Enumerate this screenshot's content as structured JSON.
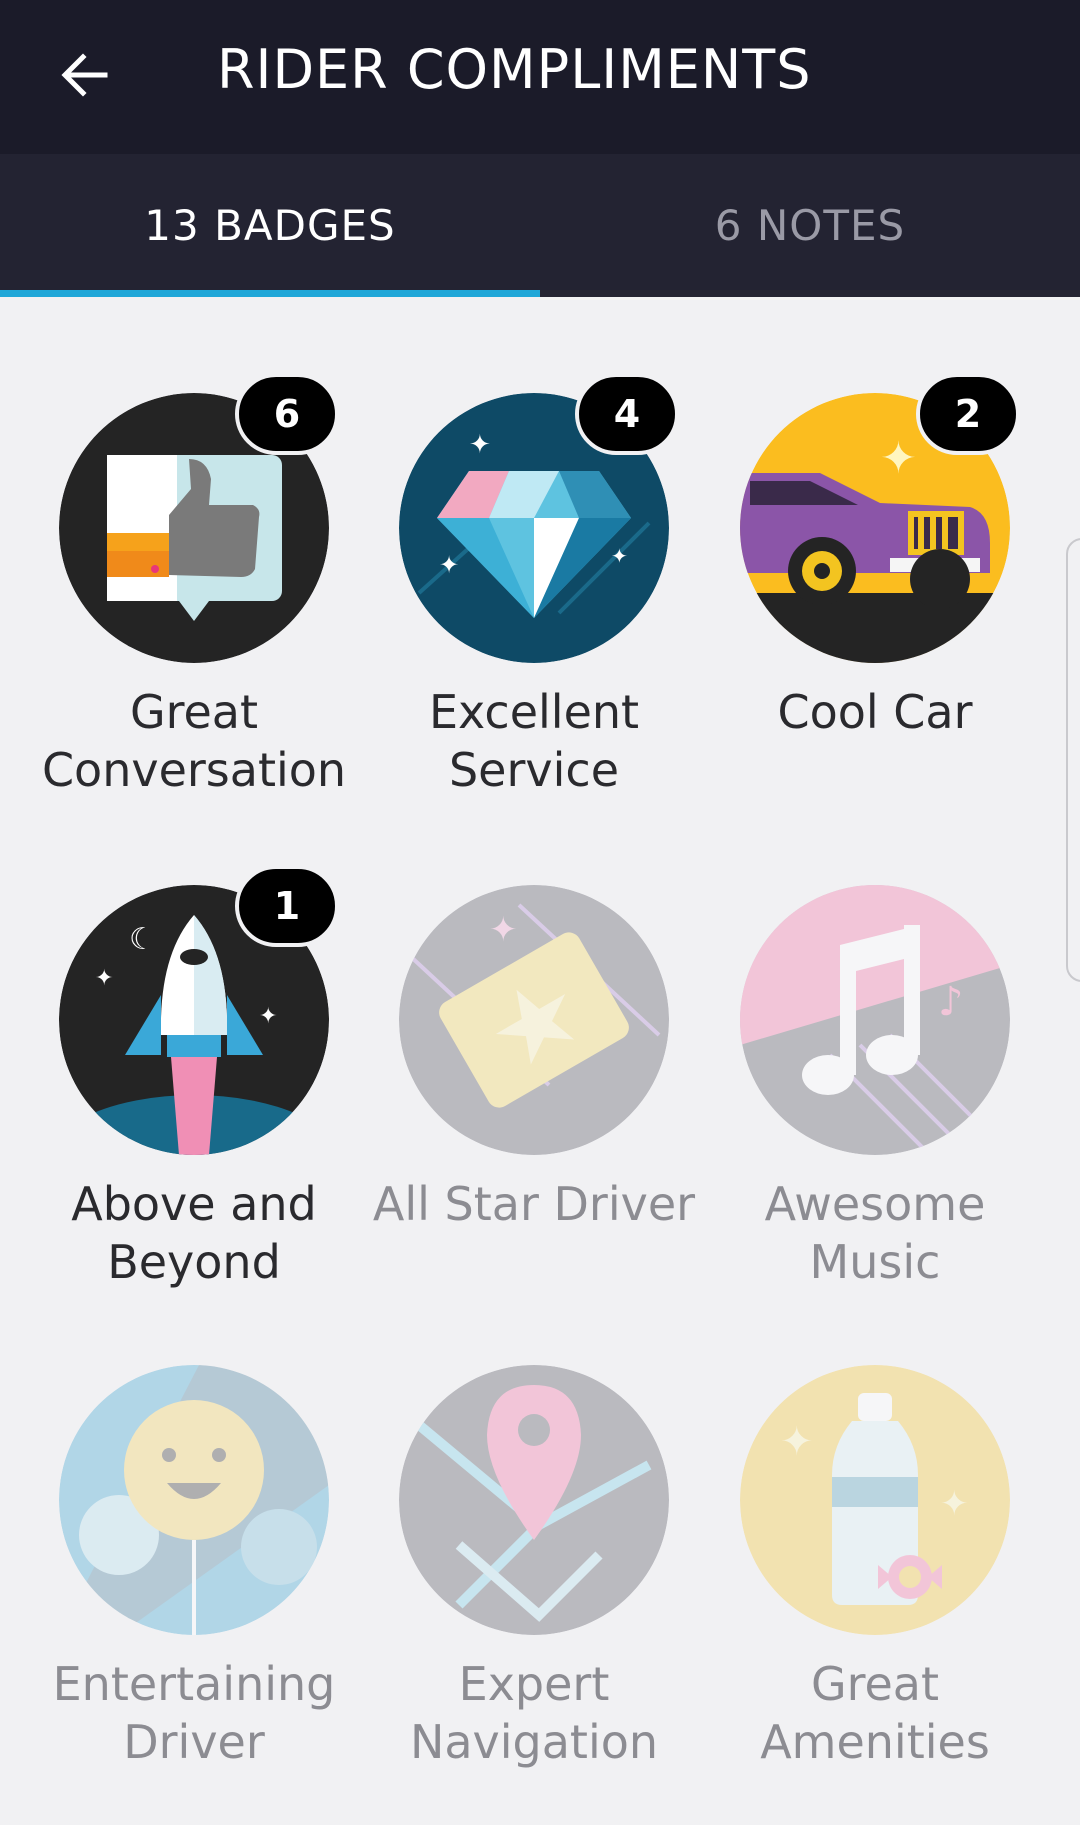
{
  "header": {
    "title": "RIDER COMPLIMENTS",
    "back_icon": "arrow-left-icon"
  },
  "tabs": [
    {
      "label": "13 BADGES",
      "active": true
    },
    {
      "label": "6 NOTES",
      "active": false
    }
  ],
  "colors": {
    "app_bar": "#1b1b29",
    "tab_bar": "#232332",
    "tab_indicator": "#1fa7d8",
    "background": "#f1f1f3"
  },
  "badges": [
    {
      "label_lines": [
        "Great",
        "Conversation"
      ],
      "count": "6",
      "earned": true,
      "icon": "thumbs-up-icon"
    },
    {
      "label_lines": [
        "Excellent",
        "Service"
      ],
      "count": "4",
      "earned": true,
      "icon": "diamond-icon"
    },
    {
      "label_lines": [
        "Cool Car",
        ""
      ],
      "count": "2",
      "earned": true,
      "icon": "car-icon"
    },
    {
      "label_lines": [
        "Above and",
        "Beyond"
      ],
      "count": "1",
      "earned": true,
      "icon": "rocket-icon"
    },
    {
      "label_lines": [
        "All Star Driver",
        ""
      ],
      "count": null,
      "earned": false,
      "icon": "ticket-star-icon"
    },
    {
      "label_lines": [
        "Awesome",
        "Music"
      ],
      "count": null,
      "earned": false,
      "icon": "music-note-icon"
    },
    {
      "label_lines": [
        "Entertaining",
        "Driver"
      ],
      "count": null,
      "earned": false,
      "icon": "smiley-balloon-icon"
    },
    {
      "label_lines": [
        "Expert",
        "Navigation"
      ],
      "count": null,
      "earned": false,
      "icon": "map-pin-icon"
    },
    {
      "label_lines": [
        "Great",
        "Amenities"
      ],
      "count": null,
      "earned": false,
      "icon": "water-bottle-icon"
    }
  ]
}
